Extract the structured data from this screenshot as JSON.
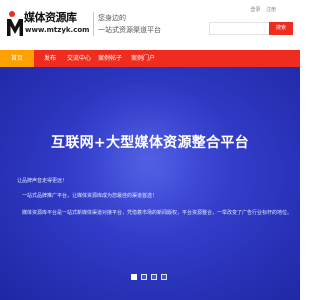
{
  "header": {
    "logo_text": "媒体资源库",
    "logo_url": "www.mtzyk.com",
    "slogan_line1": "您身边的",
    "slogan_line2": "一站式资源渠道平台",
    "top_links": [
      "登录",
      "注册"
    ],
    "search": {
      "placeholder": "",
      "button_label": "搜索"
    }
  },
  "nav": {
    "items": [
      {
        "label": "首页",
        "active": true
      },
      {
        "label": "发布"
      },
      {
        "label": "交流中心"
      },
      {
        "label": "案例帖子"
      },
      {
        "label": "案例门户"
      }
    ]
  },
  "banner": {
    "title": "互联网+大型媒体资源整合平台",
    "line1": "让品牌声音走得更远！",
    "line2": "一站式品牌推广平台，让媒体资源库成为您最佳的渠道首选！",
    "line3": "媒体资源库平台是一站式新媒体渠道对接平台，凭借着市场的新闻版权，平台资源整合，一举改变了广告行业标杆的地位。",
    "slides": 4,
    "active_slide": 1
  },
  "colors": {
    "brand_red": "#ef2c1e",
    "nav_active": "#ffa000",
    "banner_blue": "#2f39c4"
  }
}
